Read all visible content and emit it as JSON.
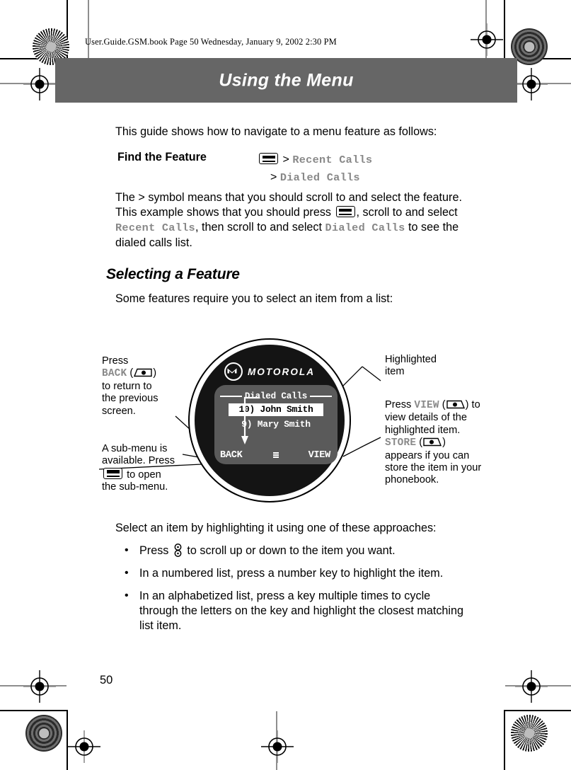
{
  "print": {
    "book_line": "User.Guide.GSM.book  Page 50  Wednesday, January 9, 2002  2:30 PM"
  },
  "header": {
    "chapter_title": "Using the Menu",
    "band_color": "#666666"
  },
  "body": {
    "intro": "This guide shows how to navigate to a menu feature as follows:",
    "find_the_feature": {
      "label": "Find the Feature",
      "menu_icon": "menu-key-icon",
      "separator": ">",
      "path_level_1": "Recent Calls",
      "path_level_2": "Dialed Calls"
    },
    "explanation": {
      "part_1": "The > symbol means that you should scroll to and select the feature. This example shows that you should press ",
      "part_2": ", scroll to and select ",
      "menu_item_1": "Recent Calls",
      "part_3": ", then scroll to and select ",
      "menu_item_2": "Dialed Calls",
      "part_4": " to see the dialed calls list."
    },
    "section_heading": "Selecting a Feature",
    "section_intro": "Some features require you to select an item from a list:",
    "select_intro": "Select an item by highlighting it using one of these approaches:",
    "approaches": [
      {
        "before": "Press ",
        "icon": "scroll-key-icon",
        "after": " to scroll up or down to the item you want."
      },
      {
        "before": "In a numbered list, press a number key to highlight the item.",
        "icon": "",
        "after": ""
      },
      {
        "before": "In an alphabetized list, press a key multiple times to cycle through the letters on the key and highlight the closest matching list item.",
        "icon": "",
        "after": ""
      }
    ]
  },
  "figure": {
    "phone": {
      "brand": "MOTOROLA",
      "screen": {
        "title": "Dialed Calls",
        "items": [
          {
            "text": "10) John Smith",
            "highlighted": true
          },
          {
            "text": "9) Mary Smith",
            "highlighted": false
          }
        ],
        "softkey_left": "BACK",
        "softkey_right": "VIEW",
        "menu_indicator": "sub-menu-indicator-icon"
      }
    },
    "callouts": {
      "left_top": {
        "l1": "Press",
        "softkey_name": "BACK",
        "l2": "to return to",
        "l3": "the previous",
        "l4": "screen."
      },
      "left_bottom": {
        "l1": "A sub-menu is",
        "l2": "available. Press",
        "l3": "to open",
        "l4": "the sub-menu."
      },
      "right_top": {
        "l1": "Highlighted",
        "l2": "item"
      },
      "right_bottom": {
        "pre": "Press ",
        "softkey_view": "VIEW",
        "mid1": "to view details of the highlighted item. ",
        "softkey_store": "STORE",
        "mid2": "appears if you can store the item in your phonebook."
      }
    }
  },
  "footer": {
    "page_number": "50"
  }
}
